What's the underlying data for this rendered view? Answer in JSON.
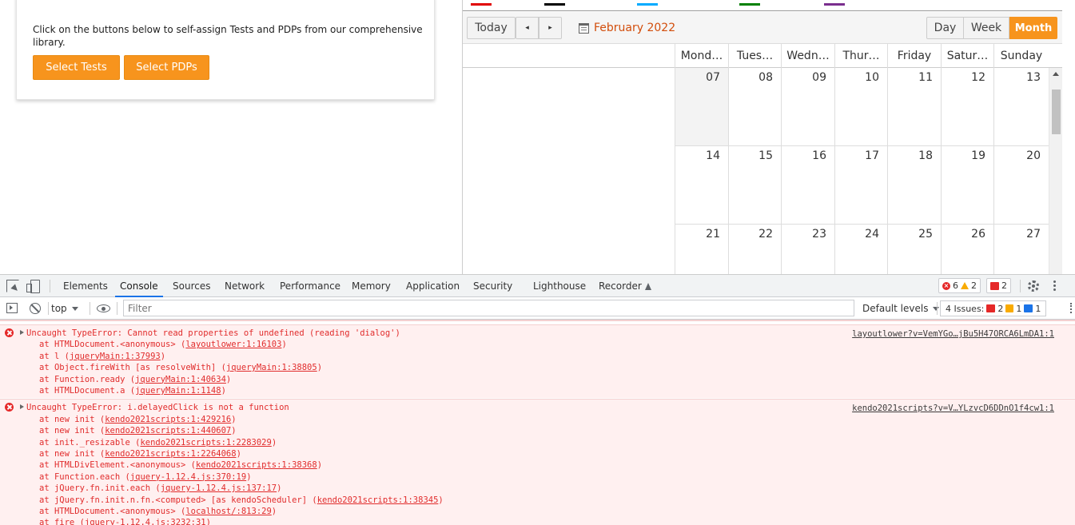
{
  "page": {
    "card_text": "Click on the buttons below to self-assign Tests and PDPs from our comprehensive library.",
    "select_tests_label": "Select Tests",
    "select_pdps_label": "Select PDPs"
  },
  "scheduler": {
    "today_label": "Today",
    "prev_label": "◂",
    "next_label": "▸",
    "current_period": "February 2022",
    "views": [
      "Day",
      "Week",
      "Month"
    ],
    "active_view": "Month",
    "legend_colors": [
      "#e00000",
      "#000000",
      "#00aaff",
      "#008000",
      "#7a2e8e"
    ],
    "weekdays": [
      "Mond…",
      "Tues…",
      "Wedn…",
      "Thur…",
      "Friday",
      "Satur…",
      "Sunday"
    ],
    "weeks": [
      [
        "07",
        "08",
        "09",
        "10",
        "11",
        "12",
        "13"
      ],
      [
        "14",
        "15",
        "16",
        "17",
        "18",
        "19",
        "20"
      ],
      [
        "21",
        "22",
        "23",
        "24",
        "25",
        "26",
        "27"
      ]
    ]
  },
  "devtools": {
    "tabs": [
      "Elements",
      "Console",
      "Sources",
      "Network",
      "Performance",
      "Memory",
      "Application",
      "Security",
      "Lighthouse",
      "Recorder"
    ],
    "active_tab": "Console",
    "error_count": "6",
    "warning_count": "2",
    "issue_badge_count": "2",
    "context": "top",
    "filter_placeholder": "Filter",
    "levels_label": "Default levels",
    "issues_label": "4 Issues:",
    "issues_errors": "2",
    "issues_warnings": "1",
    "issues_info": "1"
  },
  "console": {
    "entries": [
      {
        "message": "Uncaught TypeError: Cannot read properties of undefined (reading 'dialog')",
        "source": "layoutlower?v=VemYGo…jBu5H47ORCA6LmDA1:1",
        "stack": [
          {
            "pre": "at HTMLDocument.<anonymous> (",
            "link": "layoutlower:1:16103",
            "post": ")"
          },
          {
            "pre": "at l (",
            "link": "jqueryMain:1:37993",
            "post": ")"
          },
          {
            "pre": "at Object.fireWith [as resolveWith] (",
            "link": "jqueryMain:1:38805",
            "post": ")"
          },
          {
            "pre": "at Function.ready (",
            "link": "jqueryMain:1:40634",
            "post": ")"
          },
          {
            "pre": "at HTMLDocument.a (",
            "link": "jqueryMain:1:1148",
            "post": ")"
          }
        ]
      },
      {
        "message": "Uncaught TypeError: i.delayedClick is not a function",
        "source": "kendo2021scripts?v=V…YLzvcD6DDnO1f4cw1:1",
        "stack": [
          {
            "pre": "at new init (",
            "link": "kendo2021scripts:1:429216",
            "post": ")"
          },
          {
            "pre": "at new init (",
            "link": "kendo2021scripts:1:440607",
            "post": ")"
          },
          {
            "pre": "at init._resizable (",
            "link": "kendo2021scripts:1:2283029",
            "post": ")"
          },
          {
            "pre": "at new init (",
            "link": "kendo2021scripts:1:2264068",
            "post": ")"
          },
          {
            "pre": "at HTMLDivElement.<anonymous> (",
            "link": "kendo2021scripts:1:38368",
            "post": ")"
          },
          {
            "pre": "at Function.each (",
            "link": "jquery-1.12.4.js:370:19",
            "post": ")"
          },
          {
            "pre": "at jQuery.fn.init.each (",
            "link": "jquery-1.12.4.js:137:17",
            "post": ")"
          },
          {
            "pre": "at jQuery.fn.init.n.fn.<computed> [as kendoScheduler] (",
            "link": "kendo2021scripts:1:38345",
            "post": ")"
          },
          {
            "pre": "at HTMLDocument.<anonymous> (",
            "link": "localhost/:813:29",
            "post": ")"
          },
          {
            "pre": "at fire (",
            "link": "jquery-1.12.4.js:3232:31",
            "post": ")"
          }
        ]
      }
    ]
  }
}
